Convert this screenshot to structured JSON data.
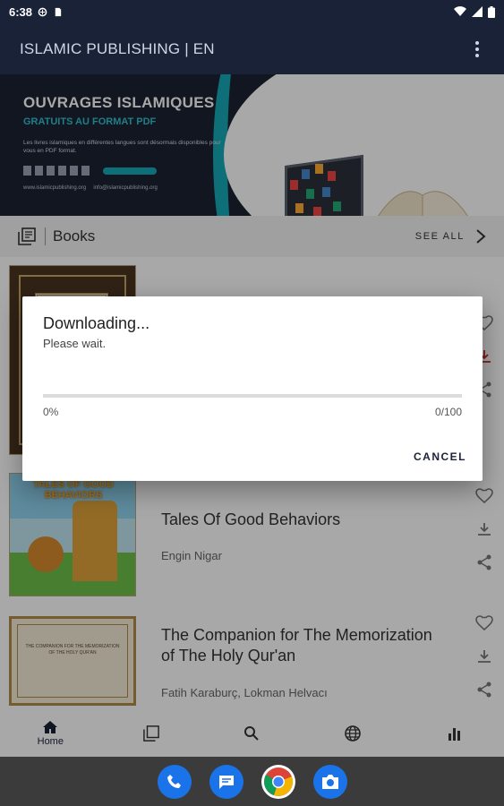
{
  "status_bar": {
    "time": "6:38",
    "icons": [
      "data-saver-icon",
      "sd-card-icon",
      "wifi-icon",
      "signal-icon",
      "battery-icon"
    ]
  },
  "app_bar": {
    "title": "ISLAMIC PUBLISHING | EN",
    "menu_icon": "more-vertical-icon"
  },
  "banner": {
    "headline": "OUVRAGES ISLAMIQUES",
    "subheadline": "GRATUITS AU FORMAT PDF",
    "description": "Les livres islamiques en différentes langues sont désormais disponibles pour vous en PDF format.",
    "site_url": "www.islamicpublishing.org",
    "email": "info@islamicpublishing.org"
  },
  "section": {
    "icon": "library-books-icon",
    "label": "Books",
    "see_all": "SEE ALL",
    "chevron": "chevron-right-icon"
  },
  "books": [
    {
      "title": "",
      "author": ""
    },
    {
      "title": "Tales Of Good Behaviors",
      "author": "Engin Nigar"
    },
    {
      "title": "The Companion for The Memorization of The Holy Qur'an",
      "author": "Fatih Karaburç, Lokman Helvacı"
    }
  ],
  "cover_texts": {
    "tales_cover": "TALES OF GOOD BEHAVIORS",
    "companion_cover": "THE COMPANION FOR THE MEMORIZATION OF THE HOLY QUR'AN"
  },
  "row_action_icons": [
    "heart-icon",
    "download-icon",
    "share-icon"
  ],
  "bottom_nav": [
    {
      "label": "Home",
      "icon": "home-icon",
      "active": true
    },
    {
      "label": "",
      "icon": "library-books-icon",
      "active": false
    },
    {
      "label": "",
      "icon": "search-icon",
      "active": false
    },
    {
      "label": "",
      "icon": "globe-icon",
      "active": false
    },
    {
      "label": "",
      "icon": "bar-chart-icon",
      "active": false
    }
  ],
  "dock_apps": [
    {
      "name": "phone-icon",
      "color": "#1a73e8"
    },
    {
      "name": "messages-icon",
      "color": "#1a73e8"
    },
    {
      "name": "chrome-icon",
      "color": "#ffffff"
    },
    {
      "name": "camera-icon",
      "color": "#1a73e8"
    }
  ],
  "dialog": {
    "title": "Downloading...",
    "message": "Please wait.",
    "progress_fraction": 0,
    "percent": "0%",
    "count": "0/100",
    "cancel": "CANCEL"
  },
  "colors": {
    "primary": "#1a2238",
    "accent": "#18a9b8"
  }
}
